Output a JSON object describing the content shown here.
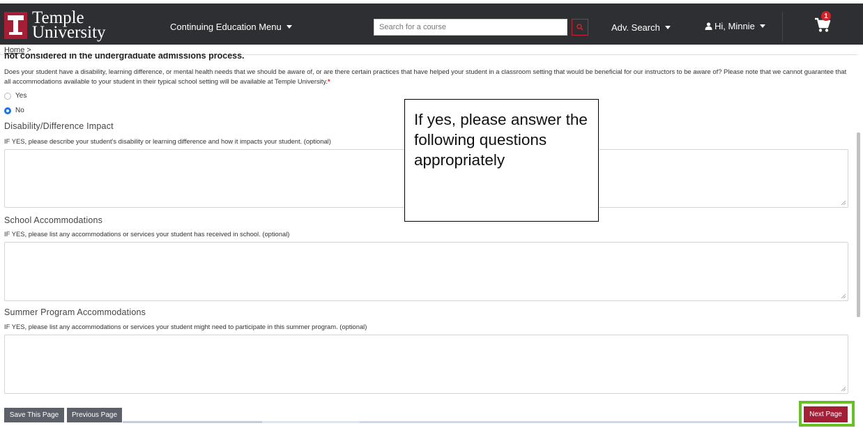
{
  "header": {
    "logo_line1": "Temple",
    "logo_line2": "University",
    "menu_label": "Continuing Education Menu",
    "search_placeholder": "Search for a course",
    "adv_search_label": "Adv. Search",
    "user_label": "Hi, Minnie",
    "cart_count": "1"
  },
  "breadcrumb": {
    "home": "Home",
    "separator": ">"
  },
  "form": {
    "cutoff_text": "not considered in the undergraduate admissions process.",
    "question_text": "Does your student have a disability, learning difference, or mental health needs that we should be aware of, or are there certain practices that have helped your student in a classroom setting that would be beneficial for our instructors to be aware of? Please note that we cannot guarantee that all accommodations available to your student in their typical school setting will be available at Temple University.",
    "required_mark": "*",
    "options": [
      {
        "label": "Yes",
        "checked": false
      },
      {
        "label": "No",
        "checked": true
      }
    ],
    "fields": [
      {
        "title": "Disability/Difference Impact",
        "hint": "IF YES, please describe your student's disability or learning difference and how it impacts your student. (optional)",
        "value": ""
      },
      {
        "title": "School Accommodations",
        "hint": "IF YES, please list any accommodations or services your student has received in school. (optional)",
        "value": ""
      },
      {
        "title": "Summer Program Accommodations",
        "hint": "IF YES, please list any accommodations or services your student might need to participate in this summer program. (optional)",
        "value": ""
      }
    ]
  },
  "callout": {
    "text": "If yes, please answer the following questions appropriately"
  },
  "buttons": {
    "save": "Save This Page",
    "previous": "Previous Page",
    "next": "Next Page"
  },
  "colors": {
    "header_bg": "#2d2f33",
    "brand_red": "#a41e35",
    "highlight_green": "#66c026",
    "radio_blue": "#1a73e8",
    "button_gray": "#5c6068"
  }
}
